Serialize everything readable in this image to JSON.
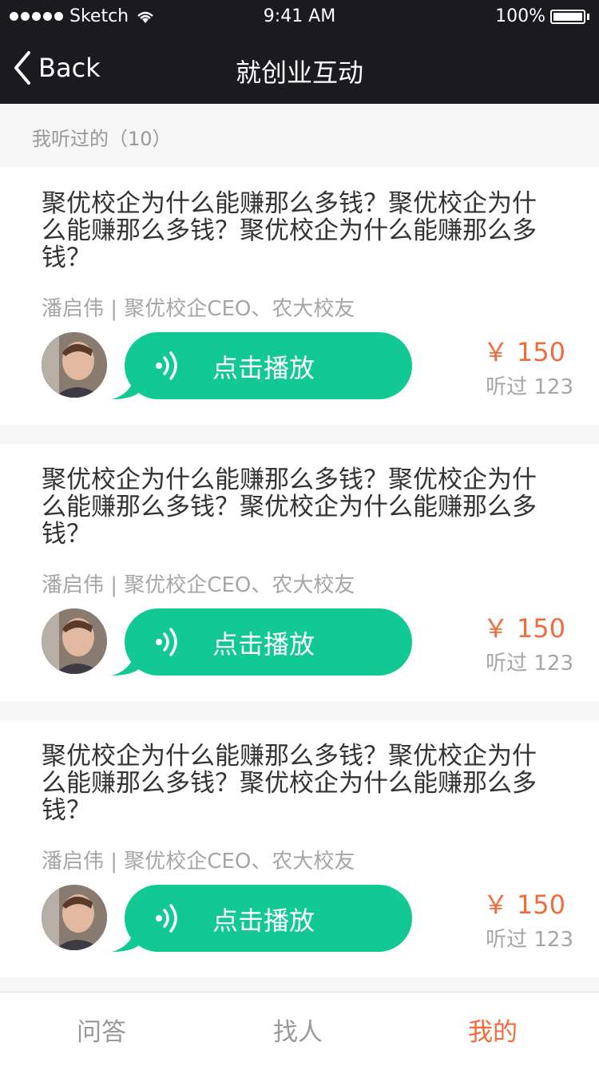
{
  "status_bar": {
    "carrier": "Sketch",
    "time": "9:41 AM",
    "battery": "100%"
  },
  "nav": {
    "back_label": "Back",
    "title": "就创业互动"
  },
  "section": {
    "header": "我听过的（10）"
  },
  "cards": [
    {
      "title": "聚优校企为什么能赚那么多钱？聚优校企为什么能赚那么多钱？聚优校企为什么能赚那么多钱？",
      "author": "潘启伟 | 聚优校企CEO、农大校友",
      "play_label": "点击播放",
      "price": "￥ 150",
      "listened": "听过 123"
    },
    {
      "title": "聚优校企为什么能赚那么多钱？聚优校企为什么能赚那么多钱？聚优校企为什么能赚那么多钱？",
      "author": "潘启伟 | 聚优校企CEO、农大校友",
      "play_label": "点击播放",
      "price": "￥ 150",
      "listened": "听过 123"
    },
    {
      "title": "聚优校企为什么能赚那么多钱？聚优校企为什么能赚那么多钱？聚优校企为什么能赚那么多钱？",
      "author": "潘启伟 | 聚优校企CEO、农大校友",
      "play_label": "点击播放",
      "price": "￥ 150",
      "listened": "听过 123"
    }
  ],
  "tabs": [
    {
      "label": "问答",
      "active": false
    },
    {
      "label": "找人",
      "active": false
    },
    {
      "label": "我的",
      "active": true
    }
  ],
  "colors": {
    "accent": "#f36b3d",
    "play_green": "#12c894",
    "bar_dark": "#1b1a1f"
  },
  "icons": {
    "back": "chevron-left-icon",
    "wifi": "wifi-icon",
    "battery": "battery-icon",
    "audio": "sound-wave-icon"
  }
}
